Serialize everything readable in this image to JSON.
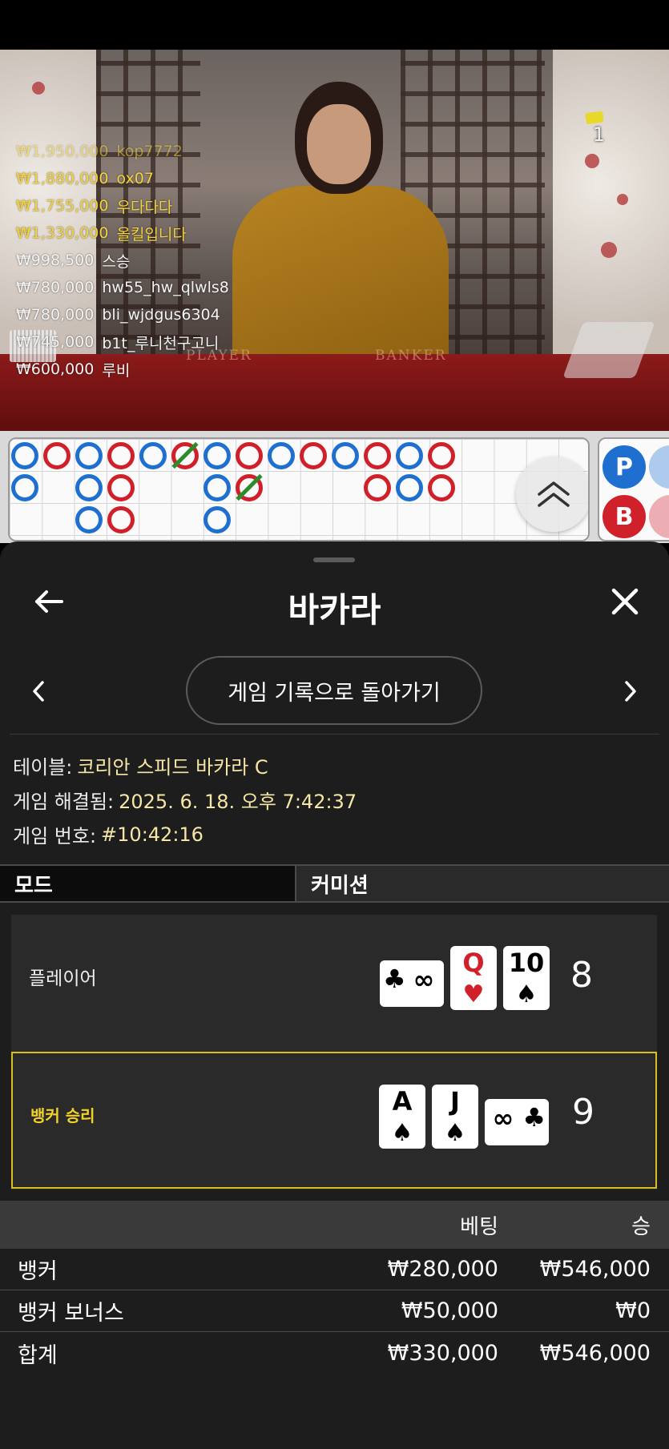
{
  "video": {
    "round_counter": "1",
    "table_labels": {
      "player": "PLAYER",
      "banker": "BANKER"
    },
    "winners": [
      {
        "amount": "₩1,950,000",
        "name": "kop7772",
        "color": "gold",
        "faded": true
      },
      {
        "amount": "₩1,880,000",
        "name": "ox07",
        "color": "gold",
        "faded": false
      },
      {
        "amount": "₩1,755,000",
        "name": "우다다다",
        "color": "gold",
        "faded": false
      },
      {
        "amount": "₩1,330,000",
        "name": "올킬입니다",
        "color": "gold",
        "faded": false
      },
      {
        "amount": "₩998,500",
        "name": "스승",
        "color": "white",
        "faded": false
      },
      {
        "amount": "₩780,000",
        "name": "hw55_hw_qlwls8",
        "color": "white",
        "faded": false
      },
      {
        "amount": "₩780,000",
        "name": "bli_wjdgus6304",
        "color": "white",
        "faded": false
      },
      {
        "amount": "₩745,000",
        "name": "b1t_루니천구고니",
        "color": "white",
        "faded": false
      },
      {
        "amount": "₩600,000",
        "name": "루비",
        "color": "white",
        "faded": false
      }
    ]
  },
  "roadmap": {
    "side_labels": {
      "player": "P",
      "banker": "B"
    }
  },
  "sheet": {
    "title": "바카라",
    "history_button": "게임 기록으로 돌아가기",
    "info": {
      "table_label": "테이블:",
      "table_value": "코리안 스피드 바카라 C",
      "resolved_label": "게임 해결됨:",
      "resolved_value": "2025. 6. 18. 오후 7:42:37",
      "number_label": "게임 번호:",
      "number_value": "#10:42:16"
    },
    "mode": {
      "label": "모드",
      "value": "커미션"
    },
    "player": {
      "label": "플레이어",
      "score": "8",
      "cards": [
        {
          "rank": "∞",
          "suit": "♣",
          "orientation": "horizontal",
          "color": "black"
        },
        {
          "rank": "Q",
          "suit": "♥",
          "orientation": "vertical",
          "color": "red"
        },
        {
          "rank": "10",
          "suit": "♠",
          "orientation": "vertical",
          "color": "black"
        }
      ]
    },
    "banker": {
      "label": "뱅커 승리",
      "score": "9",
      "cards": [
        {
          "rank": "A",
          "suit": "♠",
          "orientation": "vertical",
          "color": "black"
        },
        {
          "rank": "J",
          "suit": "♠",
          "orientation": "vertical",
          "color": "black"
        },
        {
          "rank": "∞",
          "suit": "♣",
          "orientation": "horizontal",
          "color": "black"
        }
      ]
    },
    "bets": {
      "header": {
        "bet": "베팅",
        "win": "승"
      },
      "rows": [
        {
          "label": "뱅커",
          "bet": "₩280,000",
          "win": "₩546,000"
        },
        {
          "label": "뱅커 보너스",
          "bet": "₩50,000",
          "win": "₩0"
        }
      ],
      "total": {
        "label": "합계",
        "bet": "₩330,000",
        "win": "₩546,000"
      }
    }
  },
  "colors": {
    "player_blue": "#1f6fd1",
    "banker_red": "#d0202a",
    "winner_gold": "#f3d23a",
    "banker_win_border": "#d8bf1e",
    "tie_green": "#2a8d2a"
  }
}
